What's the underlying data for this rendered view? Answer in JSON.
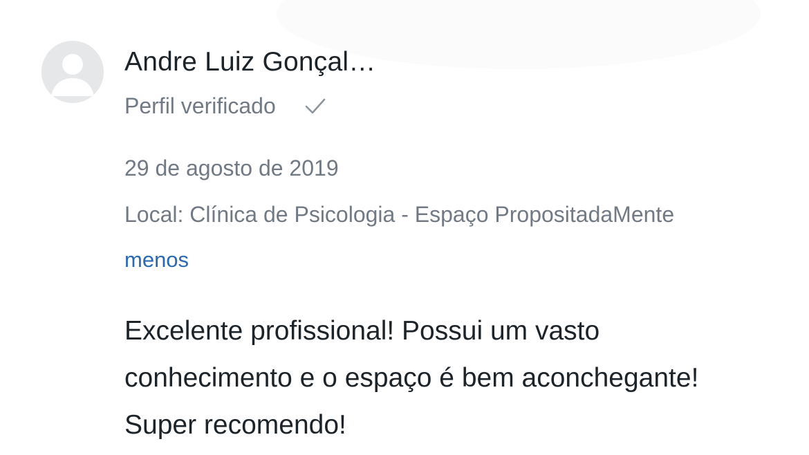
{
  "review": {
    "author": {
      "name": "Andre Luiz Gonçal…",
      "avatar_icon": "default-user-avatar-icon",
      "verified_label": "Perfil verificado",
      "verified_icon": "checkmark-icon"
    },
    "date": "29 de agosto de 2019",
    "location": "Local: Clínica de Psicologia - Espaço PropositadaMente",
    "toggle_label": "menos",
    "body": "Excelente profissional! Possui um vasto conhecimento e o espaço é bem aconchegante! Super recomendo!"
  },
  "colors": {
    "text_primary": "#1c2329",
    "text_secondary": "#717a84",
    "link": "#2a6ab3",
    "avatar_bg": "#e6e7e9"
  }
}
